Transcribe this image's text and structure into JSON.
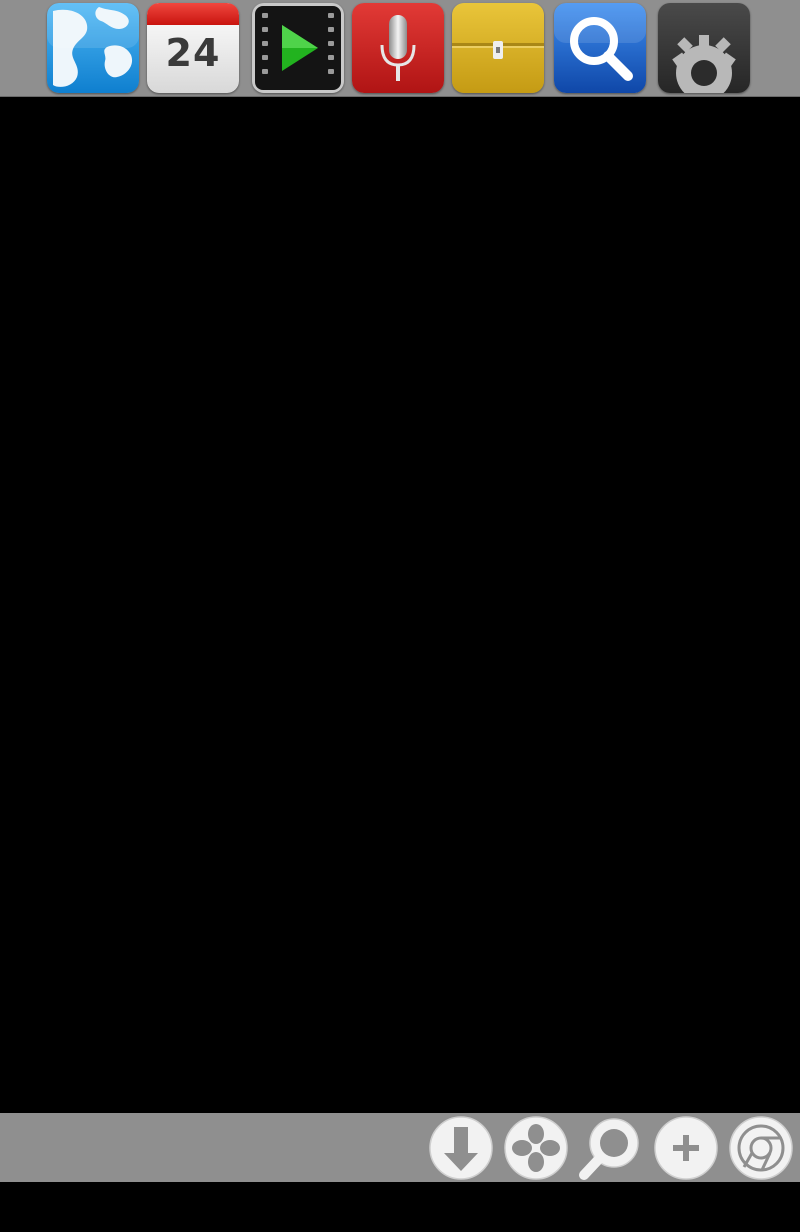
{
  "colors": {
    "dock_background": "#8f8f8f",
    "screen_background": "#000000",
    "globe_blue": "#1f9ae6",
    "calendar_red": "#e0231d",
    "video_green": "#22b31f",
    "mic_red": "#c8191a",
    "locker_yellow": "#d9b221",
    "search_blue": "#1a5fc7",
    "settings_dark": "#3a3a3a"
  },
  "top_dock": {
    "apps": [
      {
        "id": "browser",
        "icon": "globe-icon"
      },
      {
        "id": "calendar",
        "icon": "calendar-icon",
        "label": "24"
      },
      {
        "id": "video-player",
        "icon": "film-play-icon"
      },
      {
        "id": "voice-recorder",
        "icon": "microphone-icon"
      },
      {
        "id": "file-manager",
        "icon": "toolbox-icon"
      },
      {
        "id": "search",
        "icon": "magnifier-icon"
      },
      {
        "id": "settings",
        "icon": "gear-icon"
      }
    ]
  },
  "bottom_toolbar": {
    "buttons": [
      {
        "id": "download",
        "icon": "download-arrow-icon"
      },
      {
        "id": "apps",
        "icon": "four-petal-icon"
      },
      {
        "id": "search",
        "icon": "search-icon"
      },
      {
        "id": "add",
        "icon": "plus-icon"
      },
      {
        "id": "browser",
        "icon": "chrome-icon"
      }
    ]
  }
}
